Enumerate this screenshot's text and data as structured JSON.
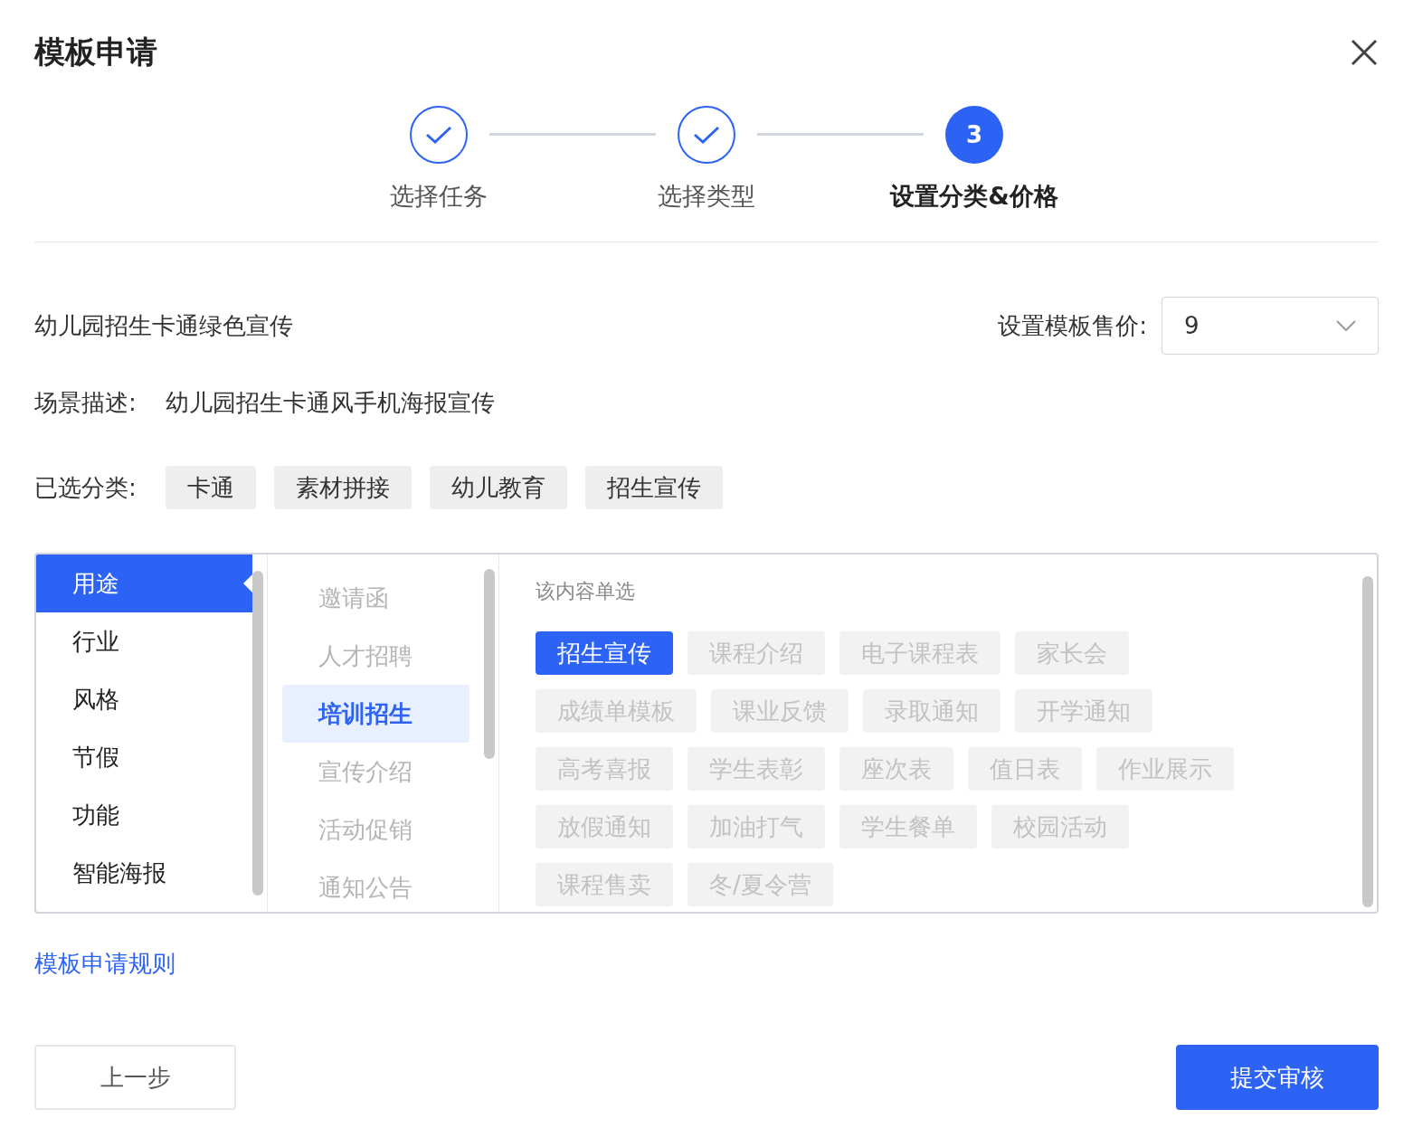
{
  "title": "模板申请",
  "steps": [
    {
      "done": true,
      "label": "选择任务"
    },
    {
      "done": true,
      "label": "选择类型"
    },
    {
      "done": false,
      "number": "3",
      "label": "设置分类&价格"
    }
  ],
  "template_name": "幼儿园招生卡通绿色宣传",
  "price": {
    "label": "设置模板售价:",
    "value": "9"
  },
  "description": {
    "label": "场景描述:",
    "value": "幼儿园招生卡通风手机海报宣传"
  },
  "selected_categories": {
    "label": "已选分类:",
    "tags": [
      "卡通",
      "素材拼接",
      "幼儿教育",
      "招生宣传"
    ]
  },
  "category_panel": {
    "primary": [
      {
        "label": "用途",
        "selected": true
      },
      {
        "label": "行业",
        "selected": false
      },
      {
        "label": "风格",
        "selected": false
      },
      {
        "label": "节假",
        "selected": false
      },
      {
        "label": "功能",
        "selected": false
      },
      {
        "label": "智能海报",
        "selected": false
      }
    ],
    "secondary": [
      {
        "label": "邀请函",
        "selected": false
      },
      {
        "label": "人才招聘",
        "selected": false
      },
      {
        "label": "培训招生",
        "selected": true
      },
      {
        "label": "宣传介绍",
        "selected": false
      },
      {
        "label": "活动促销",
        "selected": false
      },
      {
        "label": "通知公告",
        "selected": false
      }
    ],
    "hint": "该内容单选",
    "options": [
      {
        "label": "招生宣传",
        "selected": true
      },
      {
        "label": "课程介绍",
        "selected": false
      },
      {
        "label": "电子课程表",
        "selected": false
      },
      {
        "label": "家长会",
        "selected": false
      },
      {
        "label": "成绩单模板",
        "selected": false
      },
      {
        "label": "课业反馈",
        "selected": false
      },
      {
        "label": "录取通知",
        "selected": false
      },
      {
        "label": "开学通知",
        "selected": false
      },
      {
        "label": "高考喜报",
        "selected": false
      },
      {
        "label": "学生表彰",
        "selected": false
      },
      {
        "label": "座次表",
        "selected": false
      },
      {
        "label": "值日表",
        "selected": false
      },
      {
        "label": "作业展示",
        "selected": false
      },
      {
        "label": "放假通知",
        "selected": false
      },
      {
        "label": "加油打气",
        "selected": false
      },
      {
        "label": "学生餐单",
        "selected": false
      },
      {
        "label": "校园活动",
        "selected": false
      },
      {
        "label": "课程售卖",
        "selected": false
      },
      {
        "label": "冬/夏令营",
        "selected": false
      }
    ]
  },
  "rules_link": "模板申请规则",
  "back_button": "上一步",
  "submit_button": "提交审核"
}
